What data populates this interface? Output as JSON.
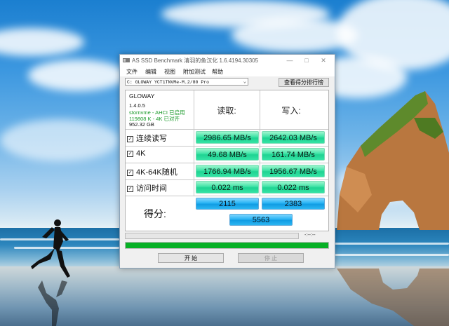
{
  "window": {
    "title": "AS SSD Benchmark 清羽的鱼汉化 1.6.4194.30305",
    "minimize": "—",
    "maximize": "□",
    "close": "✕"
  },
  "menu": [
    "文件",
    "编辑",
    "视图",
    "附加测试",
    "帮助"
  ],
  "drive": {
    "selected": "C: GLOWAY YCT1TNVMe-M.2/80 Pro",
    "arrow": "⌄"
  },
  "rank_button": "查看得分排行榜",
  "info": {
    "brand": "GLOWAY",
    "firmware": "1.4.0.5",
    "driver": "stornvme - AHCI 已启用",
    "alignment": "119808 K - 4K 已对齐",
    "capacity": "952.32 GB",
    "ok_color": "#1a9a2a"
  },
  "columns": {
    "read": "读取:",
    "write": "写入:"
  },
  "rows": [
    {
      "label": "连续读写",
      "read": "2986.65 MB/s",
      "write": "2642.03 MB/s"
    },
    {
      "label": "4K",
      "read": "49.68 MB/s",
      "write": "161.74 MB/s"
    },
    {
      "label": "4K-64K随机",
      "read": "1766.94 MB/s",
      "write": "1956.67 MB/s"
    },
    {
      "label": "访问时间",
      "read": "0.022 ms",
      "write": "0.022 ms"
    }
  ],
  "checkmark": "✓",
  "score": {
    "label": "得分:",
    "read": "2115",
    "write": "2383",
    "total": "5563"
  },
  "time_display": "-:--:--",
  "progress_main": 1.0,
  "buttons": {
    "start": "开 始",
    "stop": "停 止"
  }
}
